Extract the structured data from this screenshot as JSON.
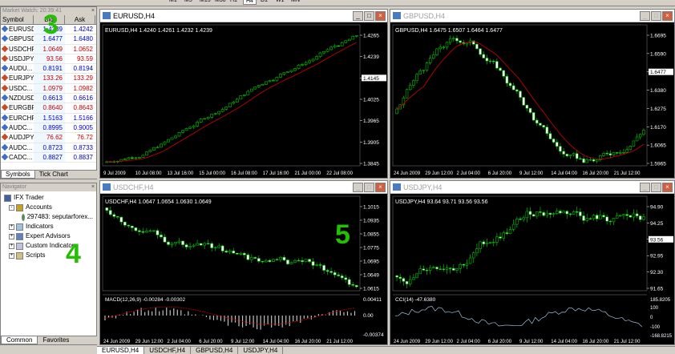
{
  "toolbar": {
    "timeframes": [
      "M1",
      "M5",
      "M15",
      "M30",
      "H1",
      "H4",
      "D1",
      "W1",
      "MN"
    ],
    "active": "H4"
  },
  "market_watch": {
    "title": "Market Watch: 20:39:41",
    "col_symbol": "Symbol",
    "col_bid": "Bid",
    "col_ask": "Ask",
    "rows": [
      {
        "s": "EURUSD",
        "b": "1.4239",
        "a": "1.4242",
        "dir": "up"
      },
      {
        "s": "GBPUSD",
        "b": "1.6477",
        "a": "1.6480",
        "dir": "up"
      },
      {
        "s": "USDCHF",
        "b": "1.0649",
        "a": "1.0652",
        "dir": "dn"
      },
      {
        "s": "USDJPY",
        "b": "93.56",
        "a": "93.59",
        "dir": "dn"
      },
      {
        "s": "AUDU...",
        "b": "0.8191",
        "a": "0.8194",
        "dir": "up"
      },
      {
        "s": "EURJPY",
        "b": "133.26",
        "a": "133.29",
        "dir": "dn"
      },
      {
        "s": "USDC...",
        "b": "1.0979",
        "a": "1.0982",
        "dir": "dn"
      },
      {
        "s": "NZDUSD",
        "b": "0.6613",
        "a": "0.6616",
        "dir": "up"
      },
      {
        "s": "EURGBP",
        "b": "0.8640",
        "a": "0.8643",
        "dir": "dn"
      },
      {
        "s": "EURCHF",
        "b": "1.5163",
        "a": "1.5166",
        "dir": "up"
      },
      {
        "s": "AUDC...",
        "b": "0.8995",
        "a": "0.9005",
        "dir": "up"
      },
      {
        "s": "AUDJPY",
        "b": "76.62",
        "a": "76.72",
        "dir": "dn"
      },
      {
        "s": "AUDC...",
        "b": "0.8723",
        "a": "0.8733",
        "dir": "up"
      },
      {
        "s": "CADC...",
        "b": "0.8827",
        "a": "0.8837",
        "dir": "up"
      }
    ],
    "tab_symbols": "Symbols",
    "tab_tick": "Tick Chart"
  },
  "navigator": {
    "title": "Navigator",
    "root": "IFX Trader",
    "accounts": "Accounts",
    "account": "297483: seputarforex...",
    "indicators": "Indicators",
    "experts": "Expert Advisors",
    "custom": "Custom Indicators",
    "scripts": "Scripts",
    "tab_common": "Common",
    "tab_favorites": "Favorites"
  },
  "annotations": {
    "three": "3",
    "four": "4",
    "five": "5"
  },
  "charts": {
    "eurusd": {
      "title": "EURUSD,H4",
      "info": "EURUSD,H4  1.4240 1.4261 1.4232 1.4239",
      "yticks": [
        "1.4265",
        "1.4239",
        "1.4145",
        "1.4025",
        "1.3965",
        "1.3905",
        "1.3845"
      ],
      "xticks": [
        "9 Jul 2009",
        "10 Jul 08:00",
        "13 Jul 16:00",
        "15 Jul 00:00",
        "16 Jul 08:00",
        "17 Jul 16:00",
        "21 Jul 00:00",
        "22 Jul 08:00"
      ]
    },
    "gbpusd": {
      "title": "GBPUSD,H4",
      "info": "GBPUSD,H4  1.6475 1.6507 1.6464 1.6477",
      "yticks": [
        "1.6695",
        "1.6590",
        "1.6477",
        "1.6380",
        "1.6275",
        "1.6170",
        "1.6065",
        "1.5965"
      ],
      "xticks": [
        "24 Jun 2009",
        "29 Jun 12:00",
        "2 Jul 04:00",
        "6 Jul 20:00",
        "9 Jul 12:00",
        "14 Jul 04:00",
        "16 Jul 20:00",
        "21 Jul 12:00"
      ]
    },
    "usdchf": {
      "title": "USDCHF,H4",
      "info": "USDCHF,H4  1.0647 1.0654 1.0630 1.0649",
      "yticks": [
        "1.1015",
        "1.0935",
        "1.0855",
        "1.0775",
        "1.0695",
        "1.0649",
        "1.0615"
      ],
      "macd_info": "MACD(12,26,9) -0.00284 -0.00302",
      "macd_ticks": [
        "0.00411",
        "0.00",
        "-0.00374"
      ],
      "xticks": [
        "24 Jun 2009",
        "29 Jun 12:00",
        "2 Jul 04:00",
        "6 Jul 20:00",
        "9 Jul 12:00",
        "14 Jul 04:00",
        "16 Jul 20:00",
        "21 Jul 12:00"
      ]
    },
    "usdjpy": {
      "title": "USDJPY,H4",
      "info": "USDJPY,H4  93.64 93.71 93.56 93.56",
      "yticks": [
        "94.90",
        "94.25",
        "93.56",
        "92.95",
        "92.30",
        "91.65"
      ],
      "cci_info": "CCI(14) -47.6380",
      "cci_ticks": [
        "185.8205",
        "100",
        "0",
        "-100",
        "-168.8215"
      ],
      "xticks": [
        "24 Jun 2009",
        "29 Jun 12:00",
        "2 Jul 04:00",
        "6 Jul 20:00",
        "9 Jul 12:00",
        "14 Jul 04:00",
        "16 Jul 20:00",
        "21 Jul 12:00"
      ]
    }
  },
  "chart_tabs": [
    "EURUSD,H4",
    "USDCHF,H4",
    "GBPUSD,H4",
    "USDJPY,H4"
  ],
  "colors": {
    "bull": "#00c000",
    "bear": "#000000",
    "ma": "#c00000",
    "bg": "#000000",
    "annot": "#22c000"
  }
}
